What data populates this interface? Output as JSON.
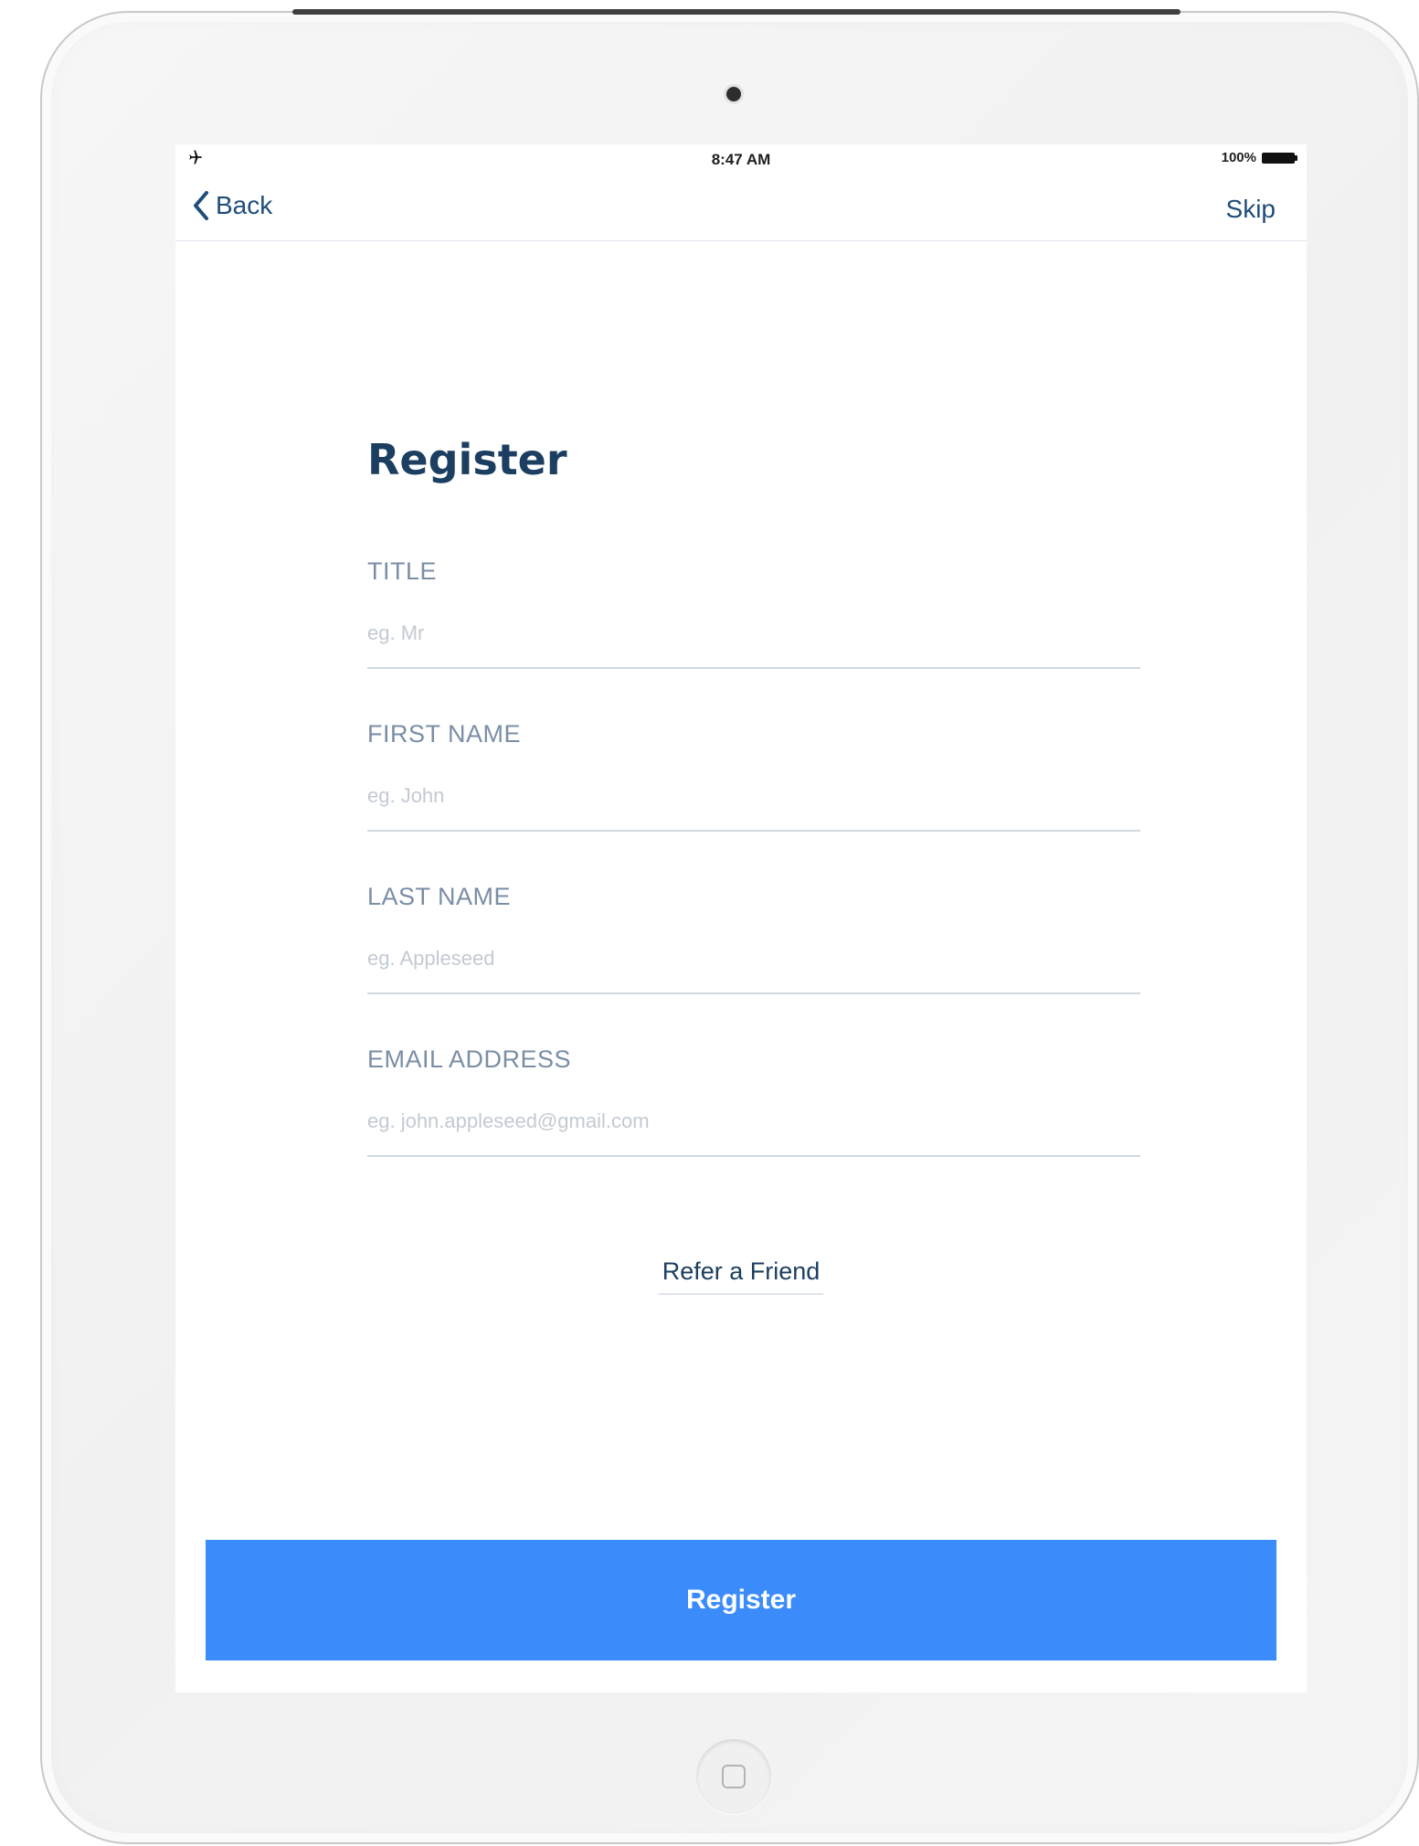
{
  "status_bar": {
    "time": "8:47 AM",
    "battery_percent": "100%",
    "icons": [
      "airplane-icon",
      "battery-icon"
    ]
  },
  "nav": {
    "back_label": "Back",
    "skip_label": "Skip",
    "back_icon": "chevron-left-icon"
  },
  "form": {
    "title": "Register",
    "fields": [
      {
        "label": "TITLE",
        "placeholder": "eg. Mr"
      },
      {
        "label": "FIRST NAME",
        "placeholder": "eg. John"
      },
      {
        "label": "LAST NAME",
        "placeholder": "eg. Appleseed"
      },
      {
        "label": "EMAIL ADDRESS",
        "placeholder": "eg. john.appleseed@gmail.com"
      }
    ],
    "refer_link": "Refer a Friend",
    "submit_label": "Register"
  },
  "colors": {
    "primary_button": "#3b8cfa",
    "heading": "#1c3e60",
    "nav_text": "#1f4d7a",
    "field_label": "#7a8ea6",
    "placeholder": "#c3cad3",
    "underline": "#d1d8e2"
  }
}
